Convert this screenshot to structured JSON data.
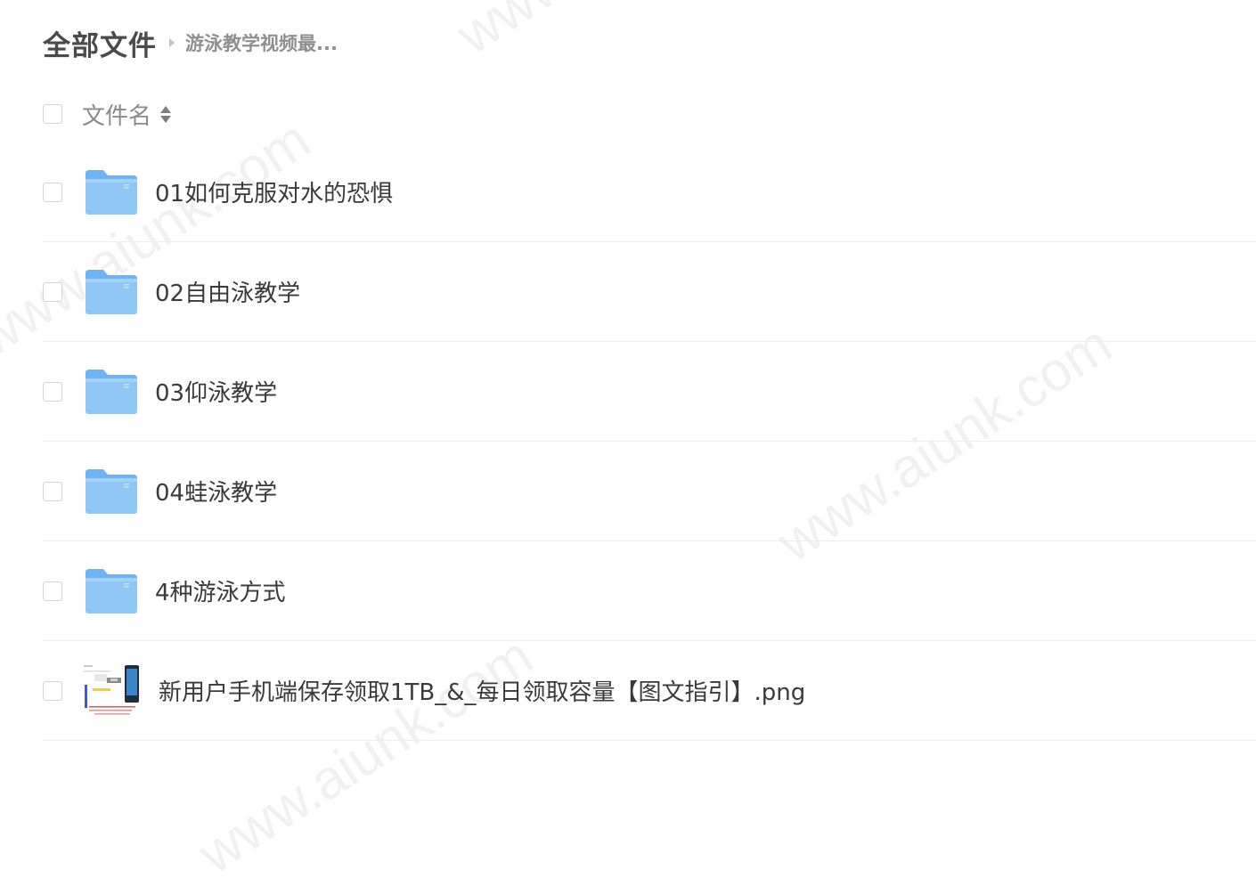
{
  "breadcrumb": {
    "root": "全部文件",
    "current": "游泳教学视频最..."
  },
  "list_header": {
    "name_column": "文件名"
  },
  "files": [
    {
      "name": "01如何克服对水的恐惧",
      "type": "folder"
    },
    {
      "name": "02自由泳教学",
      "type": "folder"
    },
    {
      "name": "03仰泳教学",
      "type": "folder"
    },
    {
      "name": "04蛙泳教学",
      "type": "folder"
    },
    {
      "name": "4种游泳方式",
      "type": "folder"
    },
    {
      "name": "新用户手机端保存领取1TB_&_每日领取容量【图文指引】.png",
      "type": "image"
    }
  ],
  "watermark": "www.aiunk.com",
  "colors": {
    "folder_body": "#8fc6f6",
    "folder_tab": "#6fb3f1",
    "divider": "#eeeeee"
  },
  "icons": {
    "folder": "folder-icon",
    "image": "image-thumbnail",
    "sort": "sort-icon",
    "separator": "chevron-right-icon"
  }
}
